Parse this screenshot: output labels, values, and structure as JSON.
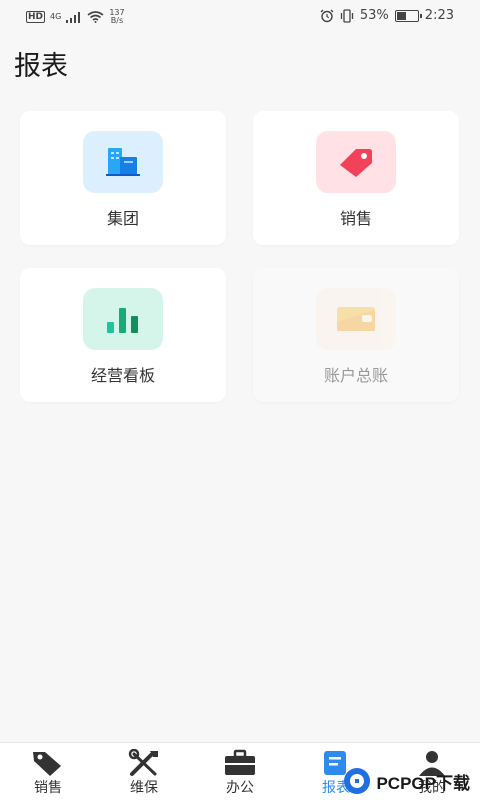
{
  "status": {
    "network_type": "4G",
    "net_speed_value": "137",
    "net_speed_unit": "B/s",
    "battery_percent": "53%",
    "battery_level": 0.53,
    "time": "2:23"
  },
  "page": {
    "title": "报表"
  },
  "cards": [
    {
      "label": "集团",
      "icon": "building-icon",
      "icon_bg": "#dcefff",
      "enabled": true
    },
    {
      "label": "销售",
      "icon": "price-tag-icon",
      "icon_bg": "#ffe1e6",
      "enabled": true
    },
    {
      "label": "经营看板",
      "icon": "bar-chart-icon",
      "icon_bg": "#d6f5ea",
      "enabled": true
    },
    {
      "label": "账户总账",
      "icon": "wallet-card-icon",
      "icon_bg": "#fbf0e3",
      "enabled": false
    }
  ],
  "tabbar": {
    "active_color": "#2f8af0",
    "items": [
      {
        "label": "销售",
        "icon": "tag-icon"
      },
      {
        "label": "维保",
        "icon": "tools-icon"
      },
      {
        "label": "办公",
        "icon": "briefcase-icon"
      },
      {
        "label": "报表",
        "icon": "report-icon",
        "active": true
      },
      {
        "label": "我的",
        "icon": "person-icon"
      }
    ]
  },
  "watermark": {
    "text": "PCPOP下载"
  }
}
